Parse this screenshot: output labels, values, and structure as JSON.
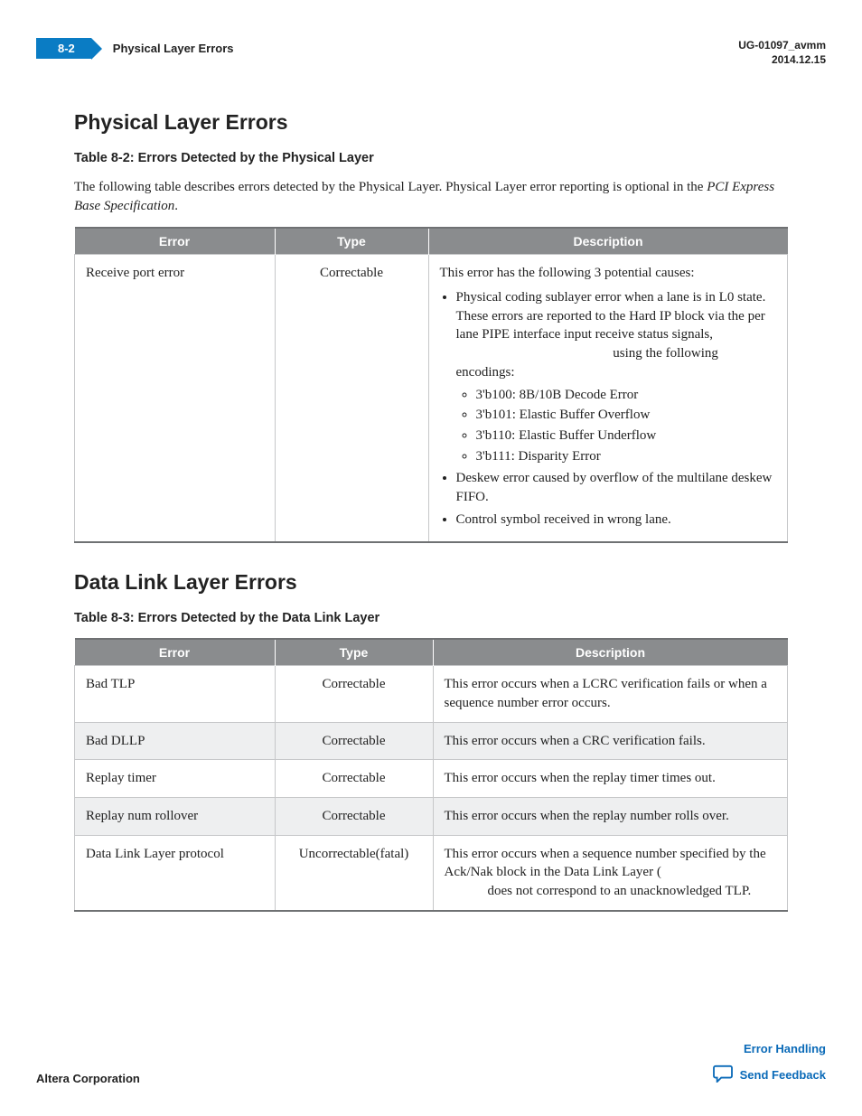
{
  "header": {
    "page_num": "8-2",
    "section_name": "Physical Layer Errors",
    "doc_id": "UG-01097_avmm",
    "doc_date": "2014.12.15"
  },
  "section1": {
    "heading": "Physical Layer Errors",
    "table_title": "Table 8-2: Errors Detected by the Physical Layer",
    "intro_a": "The following table describes errors detected by the Physical Layer. Physical Layer error reporting is optional in the ",
    "intro_b": "PCI Express Base Specification",
    "intro_c": ".",
    "cols": {
      "error": "Error",
      "type": "Type",
      "desc": "Description"
    },
    "row": {
      "error": "Receive port error",
      "type": "Correctable",
      "desc_lead": "This error has the following 3 potential causes:",
      "bullet1a": "Physical coding sublayer error when a lane is in L0 state. These errors are reported to the Hard IP block via the per lane PIPE interface input receive status signals,",
      "bullet1b": "using the following encodings:",
      "enc1": "3'b100: 8B/10B Decode Error",
      "enc2": "3'b101: Elastic Buffer Overflow",
      "enc3": "3'b110: Elastic Buffer Underflow",
      "enc4": "3'b111: Disparity Error",
      "bullet2": "Deskew error caused by overflow of the multilane deskew FIFO.",
      "bullet3": "Control symbol received in wrong lane."
    }
  },
  "section2": {
    "heading": "Data Link Layer Errors",
    "table_title": "Table 8-3: Errors Detected by the Data Link Layer",
    "cols": {
      "error": "Error",
      "type": "Type",
      "desc": "Description"
    },
    "rows": [
      {
        "error": "Bad TLP",
        "type": "Correctable",
        "desc": "This error occurs when a LCRC verification fails or when a sequence number error occurs."
      },
      {
        "error": "Bad DLLP",
        "type": "Correctable",
        "desc": "This error occurs when a CRC verification fails."
      },
      {
        "error": "Replay timer",
        "type": "Correctable",
        "desc": "This error occurs when the replay timer times out."
      },
      {
        "error": "Replay num rollover",
        "type": "Correctable",
        "desc": "This error occurs when the replay number rolls over."
      }
    ],
    "row5": {
      "error": "Data Link Layer protocol",
      "type": "Uncorrectable(fatal)",
      "desc_a": "This error occurs when a sequence number specified by the Ack/Nak block in the Data Link Layer (",
      "desc_b": "does not correspond to an unacknowledged TLP."
    }
  },
  "footer": {
    "left": "Altera Corporation",
    "link": "Error Handling",
    "feedback": "Send Feedback"
  }
}
